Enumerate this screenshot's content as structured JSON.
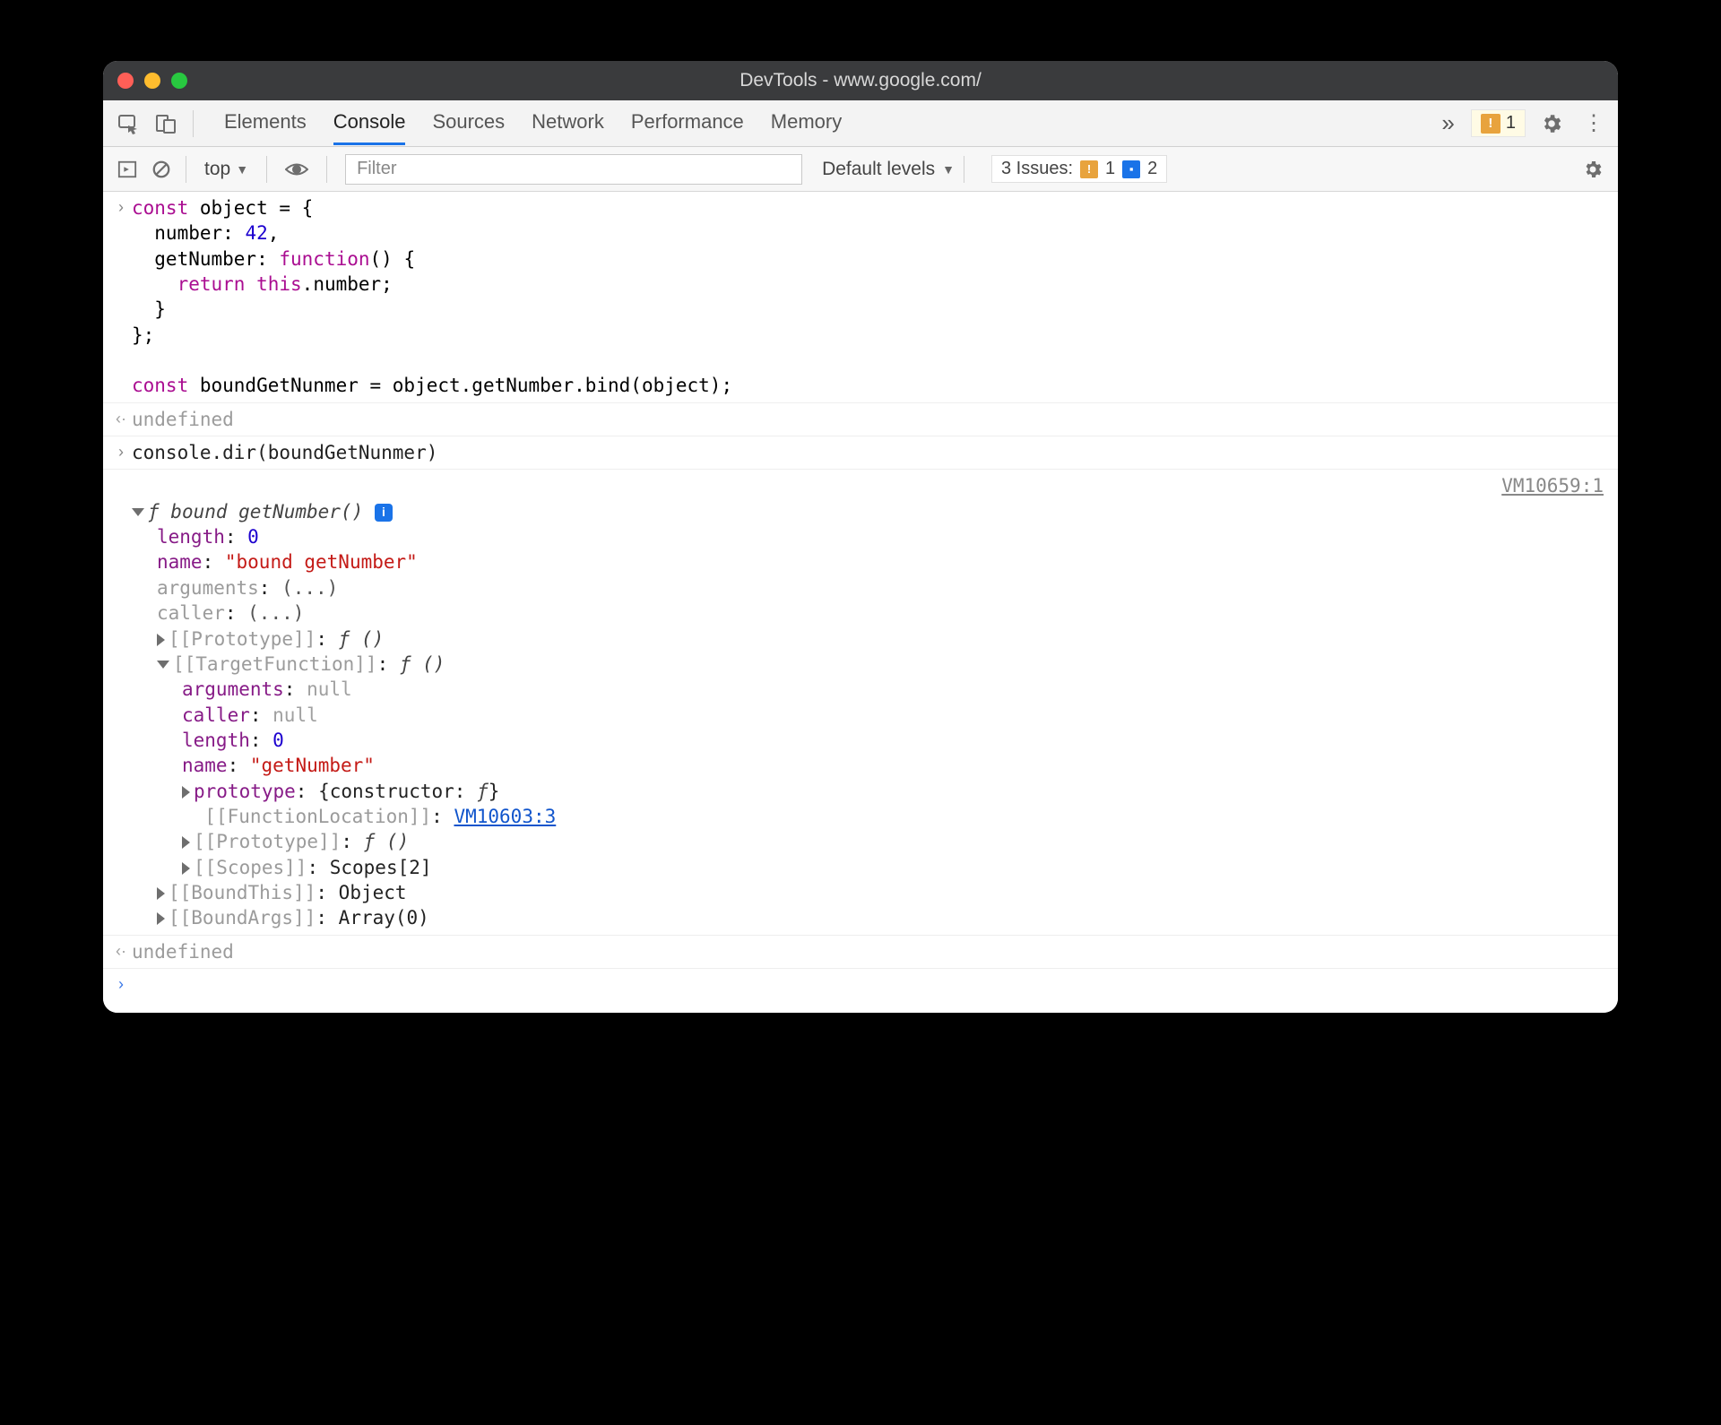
{
  "titlebar": {
    "title": "DevTools - www.google.com/"
  },
  "tabs": {
    "items": [
      "Elements",
      "Console",
      "Sources",
      "Network",
      "Performance",
      "Memory"
    ],
    "active": "Console",
    "warningCount": "1"
  },
  "filter": {
    "context": "top",
    "placeholder": "Filter",
    "levels": "Default levels",
    "issuesLabel": "3 Issues:",
    "issuesWarn": "1",
    "issuesInfo": "2"
  },
  "code1": {
    "l1a": "const",
    "l1b": " object = {",
    "l2a": "  number: ",
    "l2b": "42",
    "l2c": ",",
    "l3a": "  getNumber: ",
    "l3b": "function",
    "l3c": "() {",
    "l4a": "    ",
    "l4b": "return",
    "l4c": " ",
    "l4d": "this",
    "l4e": ".number;",
    "l5": "  }",
    "l6": "};",
    "l7": "",
    "l8a": "const",
    "l8b": " boundGetNunmer = object.getNumber.bind(object);"
  },
  "resp1": "undefined",
  "code2": "console.dir(boundGetNunmer)",
  "dir": {
    "headerF": "ƒ ",
    "headerName": "bound getNumber()",
    "sourceRef": "VM10659:1",
    "length_k": "length",
    "length_v": "0",
    "name_k": "name",
    "name_v": "\"bound getNumber\"",
    "arguments_k": "arguments",
    "ellips": "(...)",
    "caller_k": "caller",
    "proto_k": "[[Prototype]]",
    "f_paren": "ƒ ()",
    "target_k": "[[TargetFunction]]",
    "t_arguments_k": "arguments",
    "t_null": "null",
    "t_caller_k": "caller",
    "t_length_k": "length",
    "t_length_v": "0",
    "t_name_k": "name",
    "t_name_v": "\"getNumber\"",
    "t_proto_k": "prototype",
    "t_proto_v_a": "{constructor: ",
    "t_proto_v_b": "ƒ",
    "t_proto_v_c": "}",
    "t_loc_k": "[[FunctionLocation]]",
    "t_loc_v": "VM10603:3",
    "t_iproto_k": "[[Prototype]]",
    "t_scopes_k": "[[Scopes]]",
    "t_scopes_v": "Scopes[2]",
    "boundthis_k": "[[BoundThis]]",
    "boundthis_v": "Object",
    "boundargs_k": "[[BoundArgs]]",
    "boundargs_v": "Array(0)"
  },
  "resp2": "undefined"
}
